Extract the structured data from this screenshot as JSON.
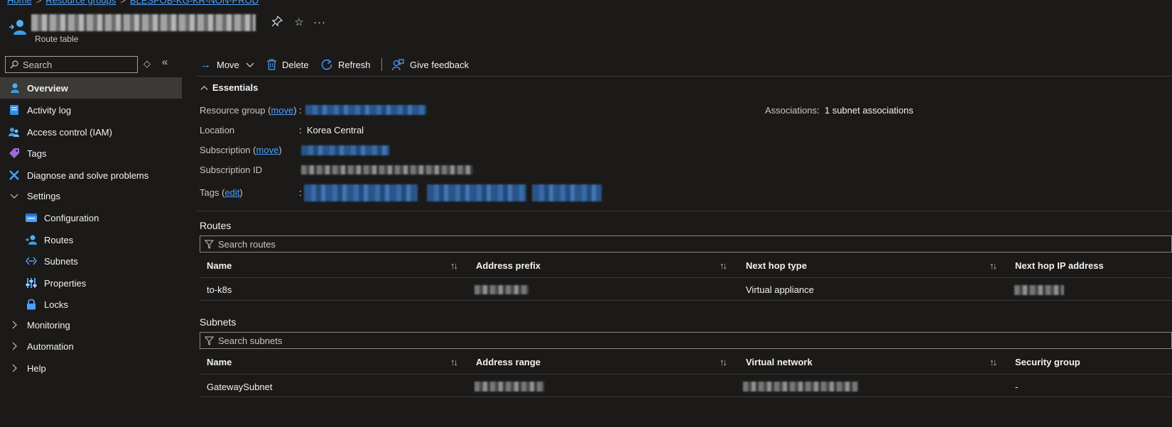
{
  "breadcrumb": [
    "Home",
    "Resource groups",
    "BLESPOB-KG-KR-NON-PROD"
  ],
  "header": {
    "subtitle": "Route table",
    "more": "···"
  },
  "sidebar": {
    "search_placeholder": "Search",
    "items": [
      {
        "label": "Overview",
        "icon": "overview-icon"
      },
      {
        "label": "Activity log",
        "icon": "activity-log-icon"
      },
      {
        "label": "Access control (IAM)",
        "icon": "iam-icon"
      },
      {
        "label": "Tags",
        "icon": "tag-icon"
      },
      {
        "label": "Diagnose and solve problems",
        "icon": "wrench-icon"
      },
      {
        "label": "Settings",
        "icon": "chevron-down-icon"
      },
      {
        "label": "Configuration",
        "icon": "configuration-icon"
      },
      {
        "label": "Routes",
        "icon": "routes-icon"
      },
      {
        "label": "Subnets",
        "icon": "subnets-icon"
      },
      {
        "label": "Properties",
        "icon": "properties-icon"
      },
      {
        "label": "Locks",
        "icon": "lock-icon"
      },
      {
        "label": "Monitoring",
        "icon": "chevron-right-icon"
      },
      {
        "label": "Automation",
        "icon": "chevron-right-icon"
      },
      {
        "label": "Help",
        "icon": "chevron-right-icon"
      }
    ]
  },
  "toolbar": {
    "move": "Move",
    "delete": "Delete",
    "refresh": "Refresh",
    "feedback": "Give feedback"
  },
  "essentials": {
    "title": "Essentials",
    "resource_group_label": "Resource group",
    "move_link": "move",
    "location_label": "Location",
    "location_value": "Korea Central",
    "subscription_label": "Subscription",
    "subscription_id_label": "Subscription ID",
    "tags_label": "Tags",
    "edit_link": "edit",
    "associations_label": "Associations",
    "associations_value": "1 subnet associations",
    "colon": ":"
  },
  "routes": {
    "title": "Routes",
    "search_placeholder": "Search routes",
    "columns": [
      "Name",
      "Address prefix",
      "Next hop type",
      "Next hop IP address"
    ],
    "rows": [
      {
        "name": "to-k8s",
        "next_hop_type": "Virtual appliance"
      }
    ]
  },
  "subnets": {
    "title": "Subnets",
    "search_placeholder": "Search subnets",
    "columns": [
      "Name",
      "Address range",
      "Virtual network",
      "Security group"
    ],
    "rows": [
      {
        "name": "GatewaySubnet",
        "security_group": "-"
      }
    ]
  }
}
